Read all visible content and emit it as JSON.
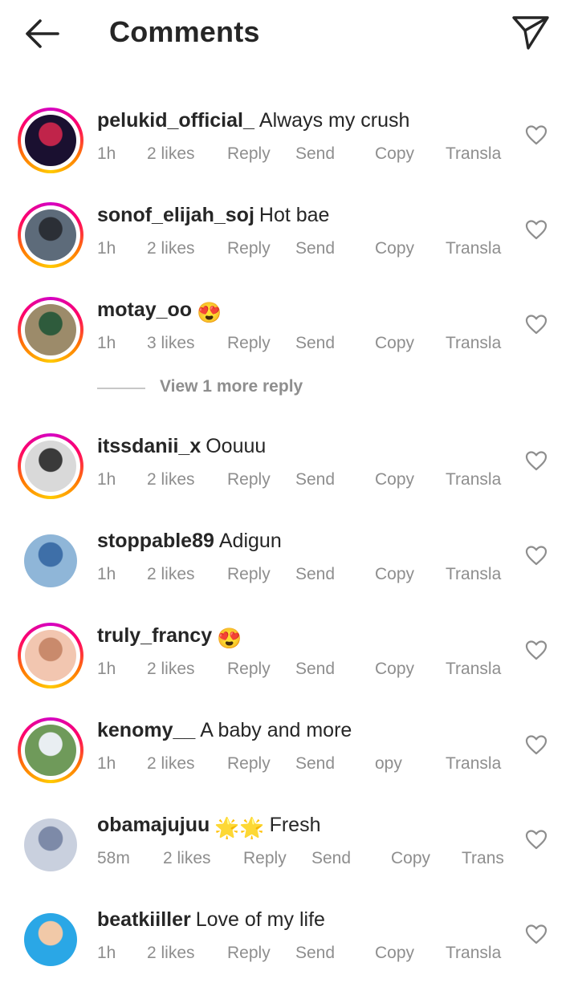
{
  "header": {
    "title": "Comments",
    "back_icon": "arrow-left-icon",
    "send_icon": "paper-plane-icon"
  },
  "comments": [
    {
      "username": "pelukid_official_",
      "text": "Always my crush",
      "emoji": "",
      "time": "1h",
      "likes": "2 likes",
      "reply": "Reply",
      "send": "Send",
      "copy": "Copy",
      "translate": "Transla",
      "ring": true,
      "avatar_colors": [
        "#1a1030",
        "#c0244a"
      ]
    },
    {
      "username": "sonof_elijah_soj",
      "text": "Hot bae",
      "emoji": "",
      "time": "1h",
      "likes": "2 likes",
      "reply": "Reply",
      "send": "Send",
      "copy": "Copy",
      "translate": "Transla",
      "ring": true,
      "avatar_colors": [
        "#5d6b7a",
        "#2b2f36"
      ]
    },
    {
      "username": "motay_oo",
      "text": "",
      "emoji": "😍",
      "time": "1h",
      "likes": "3 likes",
      "reply": "Reply",
      "send": "Send",
      "copy": "Copy",
      "translate": "Transla",
      "ring": true,
      "avatar_colors": [
        "#9c8b6a",
        "#2e5b3c"
      ]
    },
    {
      "username": "itssdanii_x",
      "text": "Oouuu",
      "emoji": "",
      "time": "1h",
      "likes": "2 likes",
      "reply": "Reply",
      "send": "Send",
      "copy": "Copy",
      "translate": "Transla",
      "ring": true,
      "avatar_colors": [
        "#d9d9d9",
        "#3a3a3a"
      ]
    },
    {
      "username": "stoppable89",
      "text": "Adigun",
      "emoji": "",
      "time": "1h",
      "likes": "2 likes",
      "reply": "Reply",
      "send": "Send",
      "copy": "Copy",
      "translate": "Transla",
      "ring": false,
      "avatar_colors": [
        "#8fb6d8",
        "#3e6fa8"
      ]
    },
    {
      "username": "truly_francy",
      "text": "",
      "emoji": "😍",
      "time": "1h",
      "likes": "2 likes",
      "reply": "Reply",
      "send": "Send",
      "copy": "Copy",
      "translate": "Transla",
      "ring": true,
      "avatar_colors": [
        "#f2c6b0",
        "#c98a6c"
      ]
    },
    {
      "username": "kenomy__",
      "text": "A baby and more",
      "emoji": "",
      "time": "1h",
      "likes": "2 likes",
      "reply": "Reply",
      "send": "Send",
      "copy": "opy",
      "translate": "Transla",
      "ring": true,
      "avatar_colors": [
        "#6f9a5a",
        "#e9eef2"
      ]
    },
    {
      "username": "obamajujuu",
      "text": "Fresh",
      "emoji": "🌟🌟",
      "time": "58m",
      "likes": "2 likes",
      "reply": "Reply",
      "send": "Send",
      "copy": "Copy",
      "translate": "Trans",
      "ring": false,
      "avatar_colors": [
        "#c9d0de",
        "#7d8aa8"
      ]
    },
    {
      "username": "beatkiiller",
      "text": "Love of my life",
      "emoji": "",
      "time": "1h",
      "likes": "2 likes",
      "reply": "Reply",
      "send": "Send",
      "copy": "Copy",
      "translate": "Transla",
      "ring": false,
      "avatar_colors": [
        "#2aa7e6",
        "#f1c9a8"
      ]
    }
  ],
  "view_more_reply": "View 1 more reply",
  "colors": {
    "text": "#262626",
    "muted": "#8e8e8e",
    "divider": "#c7c7c7"
  }
}
